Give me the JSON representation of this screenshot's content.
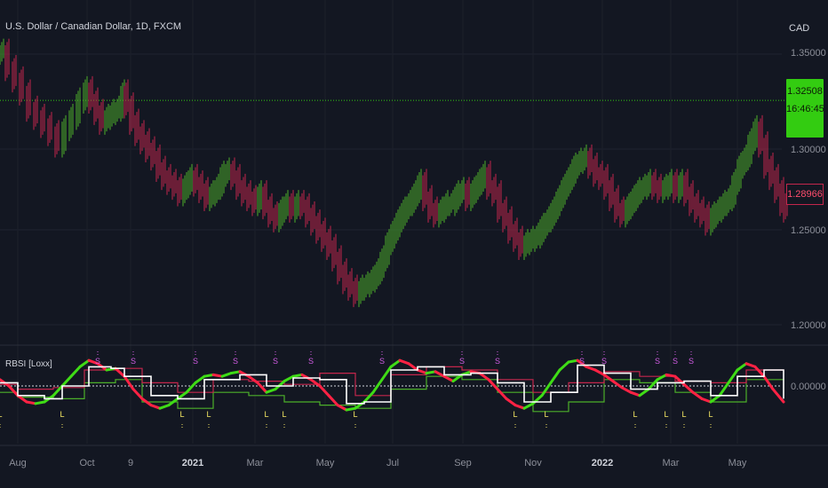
{
  "symbol_title": "U.S. Dollar / Canadian Dollar, 1D, FXCM",
  "currency": "CAD",
  "indicator_title": "RBSI [Loxx]",
  "price_tag": {
    "price": "1.32508",
    "timer": "16:46:45"
  },
  "last_tag": "1.28966",
  "colors": {
    "background": "#131722",
    "bull": "#4caf2a",
    "bear": "#c3264c",
    "signal_long": "#f5e663",
    "signal_short": "#d05ce3",
    "price_line": "#33cc11"
  },
  "chart_data": {
    "type": "line",
    "title": "U.S. Dollar / Canadian Dollar, 1D, FXCM",
    "price_axis": {
      "ticks": [
        "1.35000",
        "1.30000",
        "1.25000",
        "1.20000"
      ],
      "range": [
        1.185,
        1.365
      ]
    },
    "x_ticks": [
      {
        "label": "Aug",
        "bold": false
      },
      {
        "label": "Oct",
        "bold": false
      },
      {
        "label": "9",
        "bold": false
      },
      {
        "label": "2021",
        "bold": true
      },
      {
        "label": "Mar",
        "bold": false
      },
      {
        "label": "May",
        "bold": false
      },
      {
        "label": "Jul",
        "bold": false
      },
      {
        "label": "Sep",
        "bold": false
      },
      {
        "label": "Nov",
        "bold": false
      },
      {
        "label": "2022",
        "bold": true
      },
      {
        "label": "Mar",
        "bold": false
      },
      {
        "label": "May",
        "bold": false
      }
    ],
    "price_series": [
      [
        0,
        1.355
      ],
      [
        6,
        1.345
      ],
      [
        14,
        1.338
      ],
      [
        22,
        1.33
      ],
      [
        30,
        1.32
      ],
      [
        38,
        1.315
      ],
      [
        46,
        1.31
      ],
      [
        54,
        1.305
      ],
      [
        62,
        1.298
      ],
      [
        70,
        1.308
      ],
      [
        78,
        1.315
      ],
      [
        86,
        1.325
      ],
      [
        94,
        1.332
      ],
      [
        100,
        1.325
      ],
      [
        106,
        1.318
      ],
      [
        112,
        1.312
      ],
      [
        118,
        1.315
      ],
      [
        124,
        1.318
      ],
      [
        130,
        1.32
      ],
      [
        136,
        1.33
      ],
      [
        140,
        1.322
      ],
      [
        146,
        1.312
      ],
      [
        152,
        1.305
      ],
      [
        158,
        1.3
      ],
      [
        164,
        1.295
      ],
      [
        170,
        1.29
      ],
      [
        176,
        1.283
      ],
      [
        182,
        1.278
      ],
      [
        188,
        1.275
      ],
      [
        194,
        1.272
      ],
      [
        200,
        1.268
      ],
      [
        206,
        1.273
      ],
      [
        212,
        1.278
      ],
      [
        218,
        1.274
      ],
      [
        224,
        1.27
      ],
      [
        230,
        1.265
      ],
      [
        236,
        1.268
      ],
      [
        242,
        1.272
      ],
      [
        248,
        1.28
      ],
      [
        254,
        1.282
      ],
      [
        260,
        1.278
      ],
      [
        266,
        1.272
      ],
      [
        272,
        1.268
      ],
      [
        278,
        1.265
      ],
      [
        284,
        1.262
      ],
      [
        290,
        1.268
      ],
      [
        296,
        1.26
      ],
      [
        302,
        1.255
      ],
      [
        308,
        1.252
      ],
      [
        314,
        1.258
      ],
      [
        320,
        1.262
      ],
      [
        326,
        1.258
      ],
      [
        332,
        1.262
      ],
      [
        338,
        1.26
      ],
      [
        344,
        1.255
      ],
      [
        350,
        1.25
      ],
      [
        356,
        1.245
      ],
      [
        362,
        1.24
      ],
      [
        368,
        1.235
      ],
      [
        374,
        1.228
      ],
      [
        380,
        1.22
      ],
      [
        386,
        1.214
      ],
      [
        392,
        1.21
      ],
      [
        398,
        1.206
      ],
      [
        404,
        1.21
      ],
      [
        410,
        1.212
      ],
      [
        416,
        1.215
      ],
      [
        422,
        1.22
      ],
      [
        428,
        1.228
      ],
      [
        434,
        1.238
      ],
      [
        440,
        1.245
      ],
      [
        446,
        1.252
      ],
      [
        452,
        1.258
      ],
      [
        458,
        1.262
      ],
      [
        464,
        1.268
      ],
      [
        470,
        1.275
      ],
      [
        476,
        1.265
      ],
      [
        482,
        1.258
      ],
      [
        488,
        1.255
      ],
      [
        494,
        1.258
      ],
      [
        500,
        1.262
      ],
      [
        506,
        1.262
      ],
      [
        512,
        1.268
      ],
      [
        518,
        1.27
      ],
      [
        524,
        1.265
      ],
      [
        530,
        1.27
      ],
      [
        536,
        1.275
      ],
      [
        542,
        1.28
      ],
      [
        548,
        1.272
      ],
      [
        554,
        1.268
      ],
      [
        560,
        1.258
      ],
      [
        566,
        1.252
      ],
      [
        572,
        1.245
      ],
      [
        578,
        1.24
      ],
      [
        584,
        1.235
      ],
      [
        590,
        1.238
      ],
      [
        596,
        1.24
      ],
      [
        602,
        1.242
      ],
      [
        608,
        1.248
      ],
      [
        614,
        1.252
      ],
      [
        620,
        1.258
      ],
      [
        626,
        1.265
      ],
      [
        632,
        1.272
      ],
      [
        638,
        1.278
      ],
      [
        644,
        1.285
      ],
      [
        650,
        1.288
      ],
      [
        656,
        1.29
      ],
      [
        662,
        1.285
      ],
      [
        668,
        1.28
      ],
      [
        674,
        1.278
      ],
      [
        680,
        1.272
      ],
      [
        686,
        1.265
      ],
      [
        692,
        1.258
      ],
      [
        698,
        1.255
      ],
      [
        704,
        1.26
      ],
      [
        710,
        1.265
      ],
      [
        716,
        1.27
      ],
      [
        722,
        1.272
      ],
      [
        728,
        1.275
      ],
      [
        734,
        1.272
      ],
      [
        740,
        1.27
      ],
      [
        746,
        1.272
      ],
      [
        752,
        1.275
      ],
      [
        758,
        1.27
      ],
      [
        764,
        1.275
      ],
      [
        770,
        1.268
      ],
      [
        776,
        1.262
      ],
      [
        782,
        1.258
      ],
      [
        788,
        1.255
      ],
      [
        794,
        1.25
      ],
      [
        800,
        1.255
      ],
      [
        806,
        1.258
      ],
      [
        812,
        1.262
      ],
      [
        818,
        1.265
      ],
      [
        824,
        1.275
      ],
      [
        830,
        1.285
      ],
      [
        836,
        1.29
      ],
      [
        842,
        1.3
      ],
      [
        848,
        1.308
      ],
      [
        854,
        1.298
      ],
      [
        860,
        1.285
      ],
      [
        866,
        1.278
      ],
      [
        872,
        1.27
      ],
      [
        878,
        1.262
      ],
      [
        882,
        1.258
      ]
    ],
    "indicator": {
      "ticks": [
        "0.00000"
      ],
      "range": [
        -1,
        1
      ],
      "signal_lines": {
        "green": [
          [
            0,
            -0.2
          ],
          [
            20,
            -0.35
          ],
          [
            60,
            -0.4
          ],
          [
            95,
            0.1
          ],
          [
            130,
            0.2
          ],
          [
            160,
            -0.5
          ],
          [
            200,
            -0.7
          ],
          [
            240,
            -0.2
          ],
          [
            280,
            -0.3
          ],
          [
            320,
            -0.5
          ],
          [
            360,
            -0.6
          ],
          [
            400,
            -0.7
          ],
          [
            440,
            -0.1
          ],
          [
            480,
            0.3
          ],
          [
            520,
            0.2
          ],
          [
            560,
            -0.2
          ],
          [
            600,
            -0.8
          ],
          [
            640,
            -0.5
          ],
          [
            680,
            0.2
          ],
          [
            720,
            0.1
          ],
          [
            760,
            -0.2
          ],
          [
            800,
            -0.5
          ],
          [
            840,
            0.2
          ],
          [
            882,
            0.2
          ]
        ],
        "red": [
          [
            0,
            0.05
          ],
          [
            20,
            -0.1
          ],
          [
            60,
            -0.05
          ],
          [
            95,
            0.5
          ],
          [
            130,
            0.55
          ],
          [
            160,
            0.1
          ],
          [
            200,
            -0.2
          ],
          [
            240,
            0.2
          ],
          [
            280,
            0.15
          ],
          [
            320,
            0.05
          ],
          [
            360,
            0.4
          ],
          [
            400,
            -0.3
          ],
          [
            440,
            0.35
          ],
          [
            480,
            0.6
          ],
          [
            520,
            0.5
          ],
          [
            560,
            0.2
          ],
          [
            600,
            -0.2
          ],
          [
            640,
            0.1
          ],
          [
            680,
            0.45
          ],
          [
            720,
            0.3
          ],
          [
            760,
            0.15
          ],
          [
            800,
            0.1
          ],
          [
            840,
            0.5
          ],
          [
            882,
            0.45
          ]
        ]
      },
      "oscillator": [
        [
          0,
          0.2
        ],
        [
          10,
          0.0
        ],
        [
          20,
          -0.3
        ],
        [
          30,
          -0.5
        ],
        [
          40,
          -0.55
        ],
        [
          50,
          -0.5
        ],
        [
          60,
          -0.3
        ],
        [
          70,
          0.0
        ],
        [
          80,
          0.3
        ],
        [
          90,
          0.6
        ],
        [
          100,
          0.8
        ],
        [
          110,
          0.7
        ],
        [
          120,
          0.5
        ],
        [
          130,
          0.55
        ],
        [
          140,
          0.3
        ],
        [
          150,
          -0.1
        ],
        [
          160,
          -0.4
        ],
        [
          170,
          -0.6
        ],
        [
          180,
          -0.7
        ],
        [
          190,
          -0.6
        ],
        [
          200,
          -0.4
        ],
        [
          210,
          -0.2
        ],
        [
          220,
          0.1
        ],
        [
          230,
          0.3
        ],
        [
          240,
          0.35
        ],
        [
          250,
          0.3
        ],
        [
          260,
          0.4
        ],
        [
          270,
          0.45
        ],
        [
          280,
          0.3
        ],
        [
          290,
          0.1
        ],
        [
          300,
          -0.2
        ],
        [
          310,
          -0.1
        ],
        [
          320,
          0.15
        ],
        [
          330,
          0.3
        ],
        [
          340,
          0.35
        ],
        [
          350,
          0.2
        ],
        [
          360,
          0.0
        ],
        [
          370,
          -0.3
        ],
        [
          380,
          -0.6
        ],
        [
          390,
          -0.75
        ],
        [
          400,
          -0.7
        ],
        [
          410,
          -0.5
        ],
        [
          420,
          -0.2
        ],
        [
          430,
          0.2
        ],
        [
          440,
          0.6
        ],
        [
          450,
          0.8
        ],
        [
          460,
          0.7
        ],
        [
          470,
          0.5
        ],
        [
          480,
          0.4
        ],
        [
          490,
          0.45
        ],
        [
          500,
          0.3
        ],
        [
          510,
          0.15
        ],
        [
          520,
          0.35
        ],
        [
          530,
          0.45
        ],
        [
          540,
          0.4
        ],
        [
          550,
          0.2
        ],
        [
          560,
          -0.1
        ],
        [
          570,
          -0.4
        ],
        [
          580,
          -0.6
        ],
        [
          590,
          -0.7
        ],
        [
          600,
          -0.55
        ],
        [
          610,
          -0.3
        ],
        [
          620,
          0.1
        ],
        [
          630,
          0.5
        ],
        [
          640,
          0.75
        ],
        [
          650,
          0.8
        ],
        [
          660,
          0.6
        ],
        [
          670,
          0.5
        ],
        [
          680,
          0.35
        ],
        [
          690,
          0.15
        ],
        [
          700,
          -0.05
        ],
        [
          710,
          -0.2
        ],
        [
          720,
          -0.3
        ],
        [
          730,
          -0.1
        ],
        [
          740,
          0.2
        ],
        [
          750,
          0.35
        ],
        [
          760,
          0.3
        ],
        [
          770,
          0.05
        ],
        [
          780,
          -0.2
        ],
        [
          790,
          -0.4
        ],
        [
          800,
          -0.5
        ],
        [
          810,
          -0.3
        ],
        [
          820,
          0.1
        ],
        [
          830,
          0.5
        ],
        [
          840,
          0.7
        ],
        [
          850,
          0.6
        ],
        [
          860,
          0.3
        ],
        [
          870,
          -0.1
        ],
        [
          882,
          -0.5
        ]
      ],
      "white": [
        [
          0,
          0.1
        ],
        [
          20,
          -0.3
        ],
        [
          50,
          -0.4
        ],
        [
          70,
          0.0
        ],
        [
          100,
          0.6
        ],
        [
          125,
          0.55
        ],
        [
          140,
          0.3
        ],
        [
          170,
          -0.3
        ],
        [
          200,
          -0.4
        ],
        [
          230,
          0.2
        ],
        [
          270,
          0.35
        ],
        [
          300,
          0.0
        ],
        [
          330,
          0.25
        ],
        [
          360,
          0.2
        ],
        [
          390,
          -0.55
        ],
        [
          410,
          -0.5
        ],
        [
          440,
          0.5
        ],
        [
          470,
          0.6
        ],
        [
          500,
          0.35
        ],
        [
          530,
          0.4
        ],
        [
          560,
          0.1
        ],
        [
          590,
          -0.5
        ],
        [
          620,
          -0.2
        ],
        [
          650,
          0.65
        ],
        [
          680,
          0.4
        ],
        [
          710,
          -0.1
        ],
        [
          740,
          0.1
        ],
        [
          770,
          0.15
        ],
        [
          800,
          -0.3
        ],
        [
          830,
          0.3
        ],
        [
          860,
          0.5
        ],
        [
          882,
          -0.4
        ]
      ],
      "long_signals": [
        0,
        70,
        205,
        235,
        300,
        320,
        400,
        580,
        615,
        715,
        750,
        770,
        800
      ],
      "short_signals": [
        110,
        150,
        220,
        265,
        310,
        350,
        430,
        520,
        560,
        655,
        680,
        740,
        760,
        778
      ]
    }
  }
}
